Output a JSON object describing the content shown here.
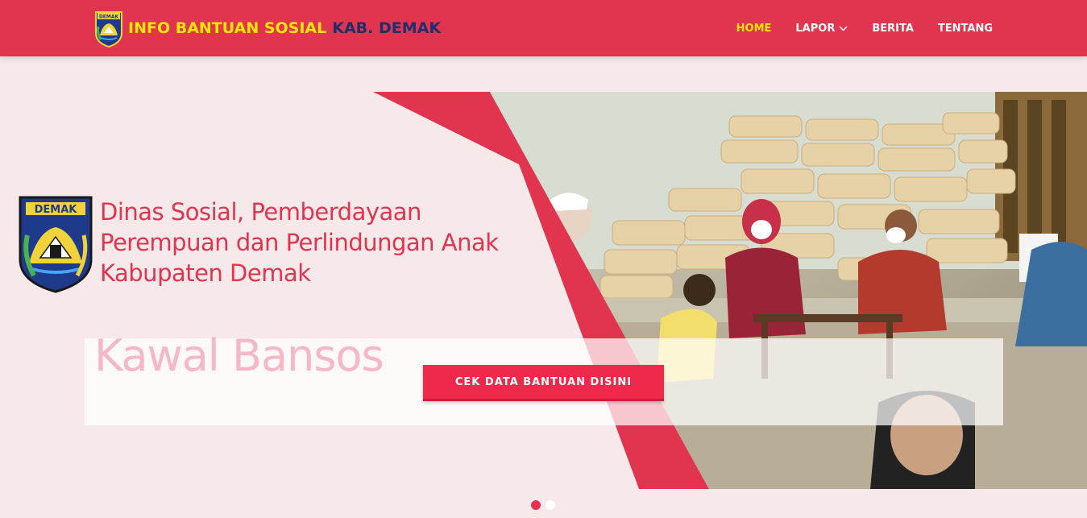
{
  "brand": {
    "title": "INFO BANTUAN SOSIAL",
    "region": "KAB. DEMAK",
    "logo_text": "DEMAK"
  },
  "nav": {
    "items": [
      {
        "label": "HOME",
        "active": true
      },
      {
        "label": "LAPOR",
        "dropdown": true
      },
      {
        "label": "BERITA"
      },
      {
        "label": "TENTANG"
      }
    ]
  },
  "hero": {
    "org_logo_text": "DEMAK",
    "org_name_lines": [
      "Dinas Sosial, Pemberdayaan",
      "Perempuan dan Perlindungan Anak",
      "Kabupaten Demak"
    ],
    "tagline": "Kawal Bansos",
    "cta_label": "CEK DATA BANTUAN DISINI",
    "slides": [
      {
        "active": true
      },
      {
        "active": false
      }
    ]
  },
  "colors": {
    "primary": "#e0344f",
    "brand_yellow": "#ffe600",
    "brand_navy": "#1f2f6e",
    "cta": "#f0284a",
    "background": "#f7e9e9"
  },
  "icons": [
    "demak-logo",
    "chevron-down-icon"
  ]
}
